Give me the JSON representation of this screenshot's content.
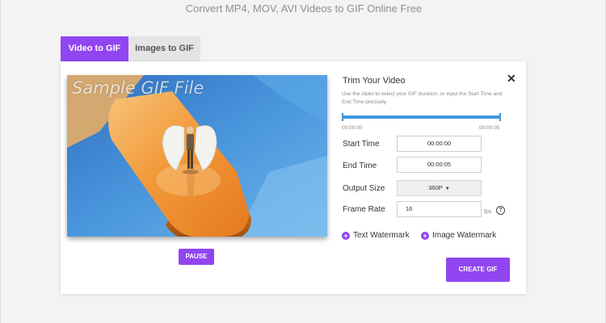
{
  "page": {
    "heading": "Convert MP4, MOV, AVI Videos to GIF Online Free",
    "accent_color": "#9145f0"
  },
  "tabs": [
    {
      "label": "Video to GIF",
      "active": true
    },
    {
      "label": "Images to GIF",
      "active": false
    }
  ],
  "video": {
    "watermark_text": "Sample GIF File",
    "pause_label": "PAUSE"
  },
  "panel": {
    "title": "Trim Your Video",
    "description": "Use the slider to select your GIF duration, or input the Start Time and End Time precisely.",
    "close_icon": "close-icon",
    "slider": {
      "start_label": "00:00:00",
      "end_label": "00:00:05",
      "selected_start_fraction": 0,
      "selected_end_fraction": 1
    },
    "fields": {
      "start_time_label": "Start Time",
      "start_time_value": "00:00:00",
      "end_time_label": "End Time",
      "end_time_value": "00:00:05",
      "output_size_label": "Output Size",
      "output_size_value": "360P",
      "frame_rate_label": "Frame Rate",
      "frame_rate_value": "16",
      "frame_rate_unit": "fps"
    },
    "text_watermark_label": "Text Watermark",
    "image_watermark_label": "Image Watermark",
    "create_label": "CREATE GIF"
  }
}
